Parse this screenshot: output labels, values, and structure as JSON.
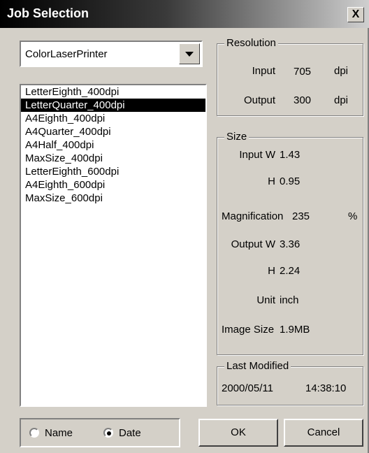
{
  "window": {
    "title": "Job Selection",
    "close_glyph": "X"
  },
  "printer": {
    "selected": "ColorLaserPrinter"
  },
  "jobs": [
    "LetterEighth_400dpi",
    "LetterQuarter_400dpi",
    "A4Eighth_400dpi",
    "A4Quarter_400dpi",
    "A4Half_400dpi",
    "MaxSize_400dpi",
    "LetterEighth_600dpi",
    "A4Eighth_600dpi",
    "MaxSize_600dpi"
  ],
  "selected_job": "LetterQuarter_400dpi",
  "resolution": {
    "legend": "Resolution",
    "input_label": "Input",
    "input_value": "705",
    "input_unit": "dpi",
    "output_label": "Output",
    "output_value": "300",
    "output_unit": "dpi"
  },
  "size": {
    "legend": "Size",
    "input_w_label": "Input W",
    "input_w_value": "1.43",
    "input_h_label": "H",
    "input_h_value": "0.95",
    "magnification_label": "Magnification",
    "magnification_value": "235",
    "magnification_unit": "%",
    "output_w_label": "Output W",
    "output_w_value": "3.36",
    "output_h_label": "H",
    "output_h_value": "2.24",
    "unit_label": "Unit",
    "unit_value": "inch",
    "image_size_label": "Image Size",
    "image_size_value": "1.9MB"
  },
  "last_modified": {
    "legend": "Last Modified",
    "date": "2000/05/11",
    "time": "14:38:10"
  },
  "sort": {
    "name_label": "Name",
    "date_label": "Date",
    "selected": "Date"
  },
  "buttons": {
    "ok": "OK",
    "cancel": "Cancel"
  },
  "colors": {
    "face": "#d4d0c8",
    "selection": "#000000"
  }
}
